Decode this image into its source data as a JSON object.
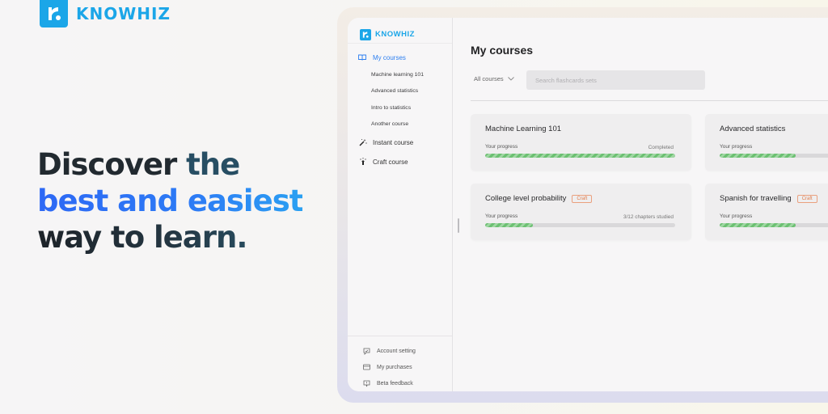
{
  "brand": {
    "name": "KNOWHIZ",
    "color": "#1ba6e8"
  },
  "hero": {
    "line1_a": "Discover",
    "line1_b": " the",
    "line2": "best and easiest",
    "line3": "way to learn."
  },
  "sidebar": {
    "brand": "KNOWHIZ",
    "my_courses": {
      "label": "My courses",
      "icon": "book-open-icon"
    },
    "courses": [
      "Machine learning 101",
      "Advanced statistics",
      "Intro to statistics",
      "Another course"
    ],
    "items": [
      {
        "label": "Instant course",
        "icon": "magic-wand-icon"
      },
      {
        "label": "Craft course",
        "icon": "sparkle-hand-icon"
      }
    ],
    "bottom": [
      {
        "label": "Account setting",
        "icon": "account-setting-icon"
      },
      {
        "label": "My purchases",
        "icon": "credit-card-icon"
      },
      {
        "label": "Beta feedback",
        "icon": "feedback-icon"
      }
    ]
  },
  "main": {
    "title": "My courses",
    "filter": {
      "selected": "All courses"
    },
    "search": {
      "placeholder": "Search flashcards sets"
    },
    "progress_label": "Your progress",
    "cards": [
      {
        "title": "Machine Learning 101",
        "badge": "",
        "status": "Completed",
        "progress": 1.0
      },
      {
        "title": "Advanced statistics",
        "badge": "",
        "status": "",
        "progress": 0.4
      },
      {
        "title": "College level probability",
        "badge": "Craft",
        "status": "3/12 chapters studied",
        "progress": 0.25
      },
      {
        "title": "Spanish for travelling",
        "badge": "Craft",
        "status": "",
        "progress": 0.4
      }
    ]
  },
  "colors": {
    "accent": "#2d7ff0",
    "progress": "#6cc072",
    "badge": "#e07b4a"
  }
}
